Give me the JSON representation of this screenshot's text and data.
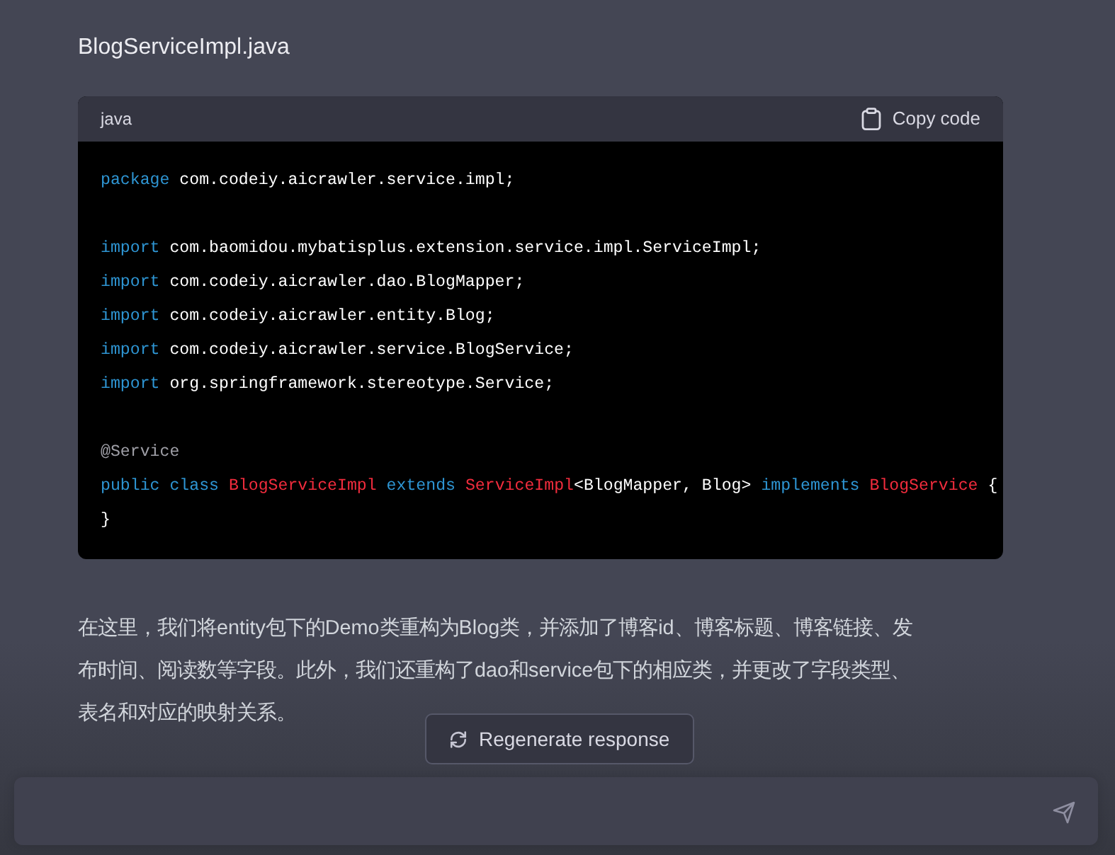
{
  "file_title": "BlogServiceImpl.java",
  "code_block": {
    "language": "java",
    "copy_label": "Copy code",
    "blocks": [
      [
        [
          {
            "kind": "keyword",
            "text": "package"
          },
          {
            "kind": "plain",
            "text": " com.codeiy.aicrawler.service.impl;"
          }
        ]
      ],
      [
        [
          {
            "kind": "keyword",
            "text": "import"
          },
          {
            "kind": "plain",
            "text": " com.baomidou.mybatisplus.extension.service.impl.ServiceImpl;"
          }
        ],
        [
          {
            "kind": "keyword",
            "text": "import"
          },
          {
            "kind": "plain",
            "text": " com.codeiy.aicrawler.dao.BlogMapper;"
          }
        ],
        [
          {
            "kind": "keyword",
            "text": "import"
          },
          {
            "kind": "plain",
            "text": " com.codeiy.aicrawler.entity.Blog;"
          }
        ],
        [
          {
            "kind": "keyword",
            "text": "import"
          },
          {
            "kind": "plain",
            "text": " com.codeiy.aicrawler.service.BlogService;"
          }
        ],
        [
          {
            "kind": "keyword",
            "text": "import"
          },
          {
            "kind": "plain",
            "text": " org.springframework.stereotype.Service;"
          }
        ]
      ],
      [
        [
          {
            "kind": "annotation",
            "text": "@Service"
          }
        ],
        [
          {
            "kind": "keyword",
            "text": "public class "
          },
          {
            "kind": "type",
            "text": "BlogServiceImpl "
          },
          {
            "kind": "keyword",
            "text": "extends "
          },
          {
            "kind": "type",
            "text": "ServiceImpl"
          },
          {
            "kind": "plain",
            "text": "<BlogMapper, Blog> "
          },
          {
            "kind": "keyword",
            "text": "implements "
          },
          {
            "kind": "type",
            "text": "BlogService"
          },
          {
            "kind": "plain",
            "text": " {"
          }
        ],
        [
          {
            "kind": "plain",
            "text": "}"
          }
        ]
      ]
    ]
  },
  "message": "在这里，我们将entity包下的Demo类重构为Blog类，并添加了博客id、博客标题、博客链接、发布时间、阅读数等字段。此外，我们还重构了dao和service包下的相应类，并更改了字段类型、表名和对应的映射关系。",
  "regenerate_button": "Regenerate response"
}
